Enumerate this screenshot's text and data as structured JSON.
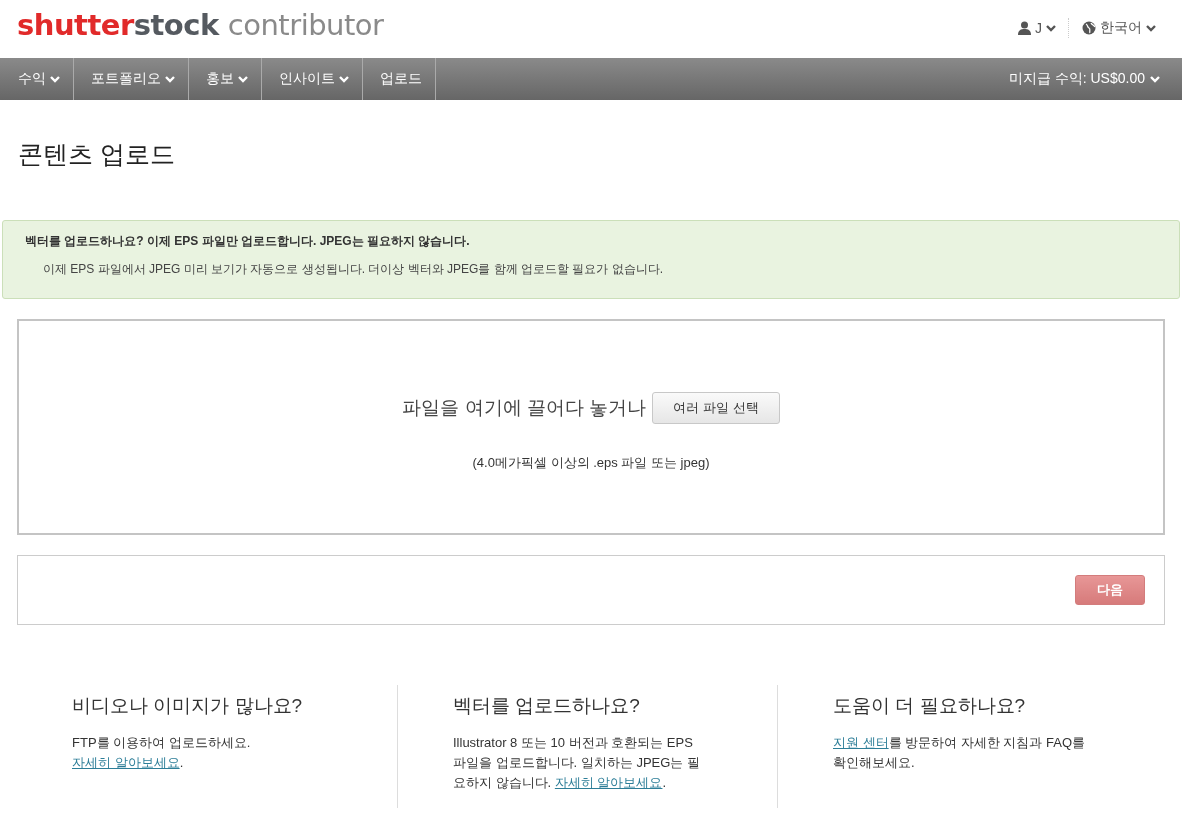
{
  "logo": {
    "brand_first": "shutter",
    "brand_second": "stock",
    "product": "contributor"
  },
  "account": {
    "user": "J",
    "language": "한국어"
  },
  "nav": [
    {
      "label": "수익",
      "has_menu": true
    },
    {
      "label": "포트폴리오",
      "has_menu": true
    },
    {
      "label": "홍보",
      "has_menu": true
    },
    {
      "label": "인사이트",
      "has_menu": true
    },
    {
      "label": "업로드",
      "has_menu": false
    }
  ],
  "earnings": {
    "label": "미지급 수익: US$0.00",
    "has_menu": true
  },
  "page_title": "콘텐츠 업로드",
  "notice": {
    "title": "벡터를 업로드하나요? 이제 EPS 파일만 업로드합니다. JPEG는 필요하지 않습니다.",
    "body": "이제 EPS 파일에서 JPEG 미리 보기가 자동으로 생성됩니다. 더이상 벡터와 JPEG를 함께 업로드할 필요가 없습니다."
  },
  "dropzone": {
    "prompt": "파일을 여기에 끌어다 놓거나",
    "button": "여러 파일 선택",
    "hint": "(4.0메가픽셀 이상의 .eps 파일 또는 jpeg)"
  },
  "next_button": {
    "label": "다음",
    "disabled": true
  },
  "help": [
    {
      "title": "비디오나 이미지가 많나요?",
      "body": [
        {
          "kind": "text",
          "text": "FTP를 이용하여 업로드하세요. "
        },
        {
          "kind": "link",
          "text": "자세히 알아보세요"
        },
        {
          "kind": "text",
          "text": "."
        }
      ]
    },
    {
      "title": "벡터를 업로드하나요?",
      "body": [
        {
          "kind": "text",
          "text": "Illustrator 8 또는 10 버전과 호환되는 EPS 파일을 업로드합니다. 일치하는 JPEG는 필요하지 않습니다. "
        },
        {
          "kind": "link",
          "text": "자세히 알아보세요"
        },
        {
          "kind": "text",
          "text": "."
        }
      ]
    },
    {
      "title": "도움이 더 필요하나요?",
      "body": [
        {
          "kind": "link",
          "text": "지원 센터"
        },
        {
          "kind": "text",
          "text": "를 방문하여 자세한 지침과 FAQ를 확인해보세요."
        }
      ]
    }
  ]
}
